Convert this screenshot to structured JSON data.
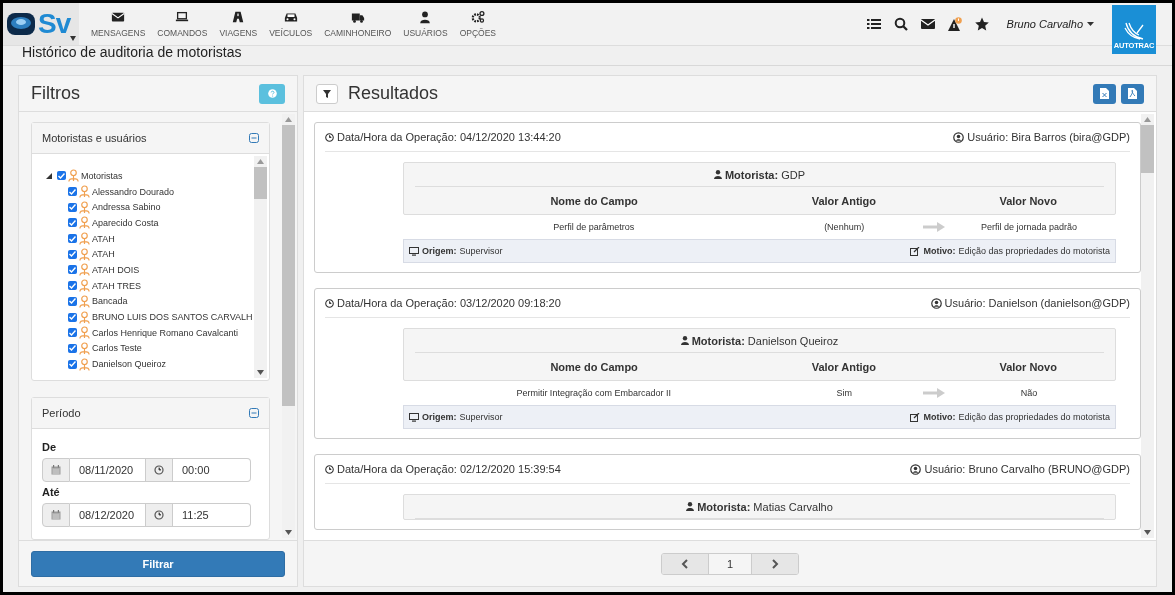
{
  "topbar": {
    "logo": "Sv",
    "nav": [
      {
        "label": "MENSAGENS"
      },
      {
        "label": "COMANDOS"
      },
      {
        "label": "VIAGENS"
      },
      {
        "label": "VEÍCULOS"
      },
      {
        "label": "CAMINHONEIRO"
      },
      {
        "label": "USUÁRIOS"
      },
      {
        "label": "OPÇÕES"
      }
    ],
    "user": "Bruno Carvalho",
    "brand": "AUTOTRAC"
  },
  "page_title": "Histórico de auditoria de motoristas",
  "filters": {
    "title": "Filtros",
    "drivers_section": {
      "title": "Motoristas e usuários",
      "expanded": true,
      "tree": [
        {
          "label": "Motoristas",
          "checked": true,
          "expanded": true,
          "children": [
            {
              "label": "Alessandro Dourado",
              "checked": true
            },
            {
              "label": "Andressa Sabino",
              "checked": true
            },
            {
              "label": "Aparecido Costa",
              "checked": true
            },
            {
              "label": "ATAH",
              "checked": true
            },
            {
              "label": "ATAH",
              "checked": true
            },
            {
              "label": "ATAH DOIS",
              "checked": true
            },
            {
              "label": "ATAH TRES",
              "checked": true
            },
            {
              "label": "Bancada",
              "checked": true
            },
            {
              "label": "BRUNO LUIS DOS SANTOS CARVALH",
              "checked": true
            },
            {
              "label": "Carlos Henrique Romano Cavalcanti",
              "checked": true
            },
            {
              "label": "Carlos Teste",
              "checked": true
            },
            {
              "label": "Danielson Queiroz",
              "checked": true
            }
          ]
        }
      ]
    },
    "period_section": {
      "title": "Período",
      "expanded": true,
      "ranges": [
        {
          "label": "De",
          "date": "08/11/2020",
          "time": "00:00"
        },
        {
          "label": "Até",
          "date": "08/12/2020",
          "time": "11:25"
        }
      ]
    },
    "button": "Filtrar"
  },
  "results": {
    "title": "Resultados",
    "cards": [
      {
        "datetime": "Data/Hora da Operação: 04/12/2020 13:44:20",
        "user": "Usuário: Bira Barros (bira@GDP)",
        "driver": "**Motorista:** GDP",
        "columns": [
          "Nome do Campo",
          "Valor Antigo",
          "Valor Novo"
        ],
        "rows": [
          {
            "field": "Perfil de parâmetros",
            "old": "(Nenhum)",
            "new": "Perfil de jornada padrão"
          }
        ],
        "origin": "**Origem:** Supervisor",
        "reason": "**Motivo:** Edição das propriedades do motorista"
      },
      {
        "datetime": "Data/Hora da Operação: 03/12/2020 09:18:20",
        "user": "Usuário: Danielson (danielson@GDP)",
        "driver": "**Motorista:** Danielson Queiroz",
        "columns": [
          "Nome do Campo",
          "Valor Antigo",
          "Valor Novo"
        ],
        "rows": [
          {
            "field": "Permitir Integração com Embarcador II",
            "old": "Sim",
            "new": "Não"
          }
        ],
        "origin": "**Origem:** Supervisor",
        "reason": "**Motivo:** Edição das propriedades do motorista"
      },
      {
        "datetime": "Data/Hora da Operação: 02/12/2020 15:39:54",
        "user": "Usuário: Bruno Carvalho (BRUNO@GDP)",
        "driver": "**Motorista:** Matias Carvalho"
      }
    ],
    "pages": [
      {
        "label": "1",
        "selected": true
      }
    ]
  }
}
